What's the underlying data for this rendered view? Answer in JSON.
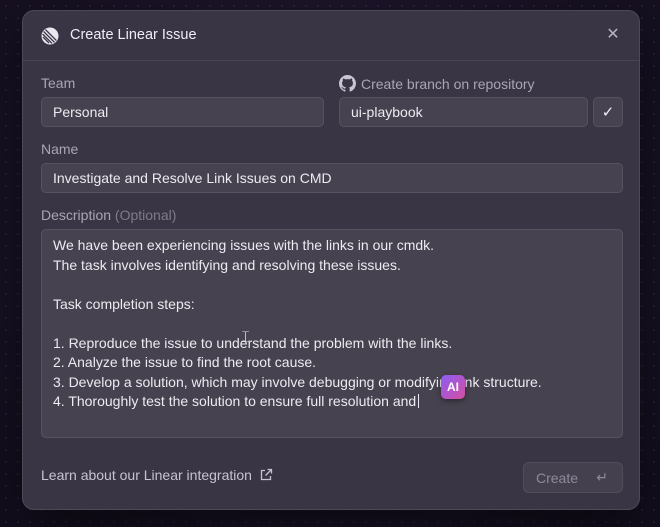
{
  "modal": {
    "title": "Create Linear Issue",
    "close_icon": "close-icon"
  },
  "team": {
    "label": "Team",
    "value": "Personal"
  },
  "branch": {
    "label": "Create branch on repository",
    "value": "ui-playbook",
    "checked": true
  },
  "name": {
    "label": "Name",
    "value": "Investigate and Resolve Link Issues on CMD"
  },
  "description": {
    "label": "Description",
    "optional_label": "(Optional)",
    "lines": [
      "We have been experiencing issues with the links in our cmdk.",
      "The task involves identifying and resolving these issues.",
      "",
      "Task completion steps:",
      "",
      "1. Reproduce the issue to understand the problem with the links.",
      "2. Analyze the issue to find the root cause.",
      "3. Develop a solution, which may involve debugging or modifying link structure.",
      "4. Thoroughly test the solution to ensure full resolution and"
    ],
    "ai_badge": "AI"
  },
  "footer": {
    "learn_link": "Learn about our Linear integration",
    "create_label": "Create",
    "create_shortcut": "↵"
  },
  "colors": {
    "modal_bg": "#3a3545",
    "field_bg": "#47424f",
    "ai_gradient_start": "#8b5cf6",
    "ai_gradient_end": "#d64fa0"
  }
}
